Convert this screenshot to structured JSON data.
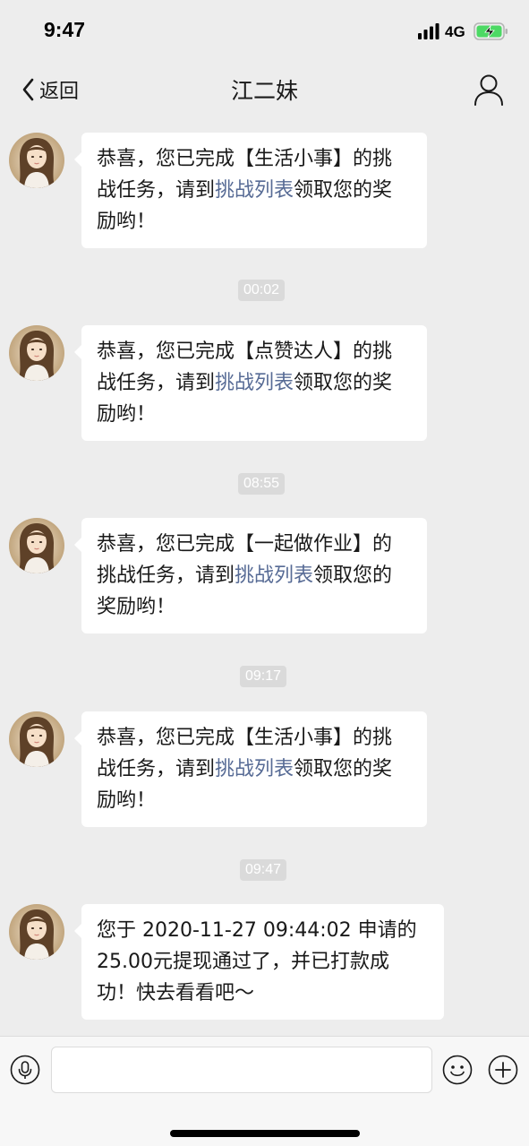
{
  "status_bar": {
    "time": "9:47",
    "network": "4G",
    "signal_icon": "signal-bars-icon",
    "battery_icon": "battery-charging-icon",
    "battery_color": "#4cd964"
  },
  "nav": {
    "back_label": "返回",
    "title": "江二妹",
    "back_icon": "chevron-left-icon",
    "profile_icon": "person-icon"
  },
  "messages": [
    {
      "before": "恭喜，您已完成【生活小事】的挑战任务，请到",
      "link": "挑战列表",
      "after": "领取您的奖励哟！"
    },
    {
      "before": "恭喜，您已完成【点赞达人】的挑战任务，请到",
      "link": "挑战列表",
      "after": "领取您的奖励哟！"
    },
    {
      "before": "恭喜，您已完成【一起做作业】的挑战任务，请到",
      "link": "挑战列表",
      "after": "领取您的奖励哟！"
    },
    {
      "before": "恭喜，您已完成【生活小事】的挑战任务，请到",
      "link": "挑战列表",
      "after": "领取您的奖励哟！"
    },
    {
      "text": "您于 2020-11-27 09:44:02 申请的 25.00元提现通过了，并已打款成功！快去看看吧～"
    }
  ],
  "timestamps": [
    "00:02",
    "08:55",
    "09:17",
    "09:47"
  ],
  "input_bar": {
    "voice_icon": "microphone-icon",
    "emoji_icon": "smiley-icon",
    "plus_icon": "plus-circle-icon",
    "input_value": ""
  },
  "colors": {
    "background": "#ededed",
    "bubble": "#ffffff",
    "link": "#576b95",
    "timestamp_bg": "#dadada"
  }
}
